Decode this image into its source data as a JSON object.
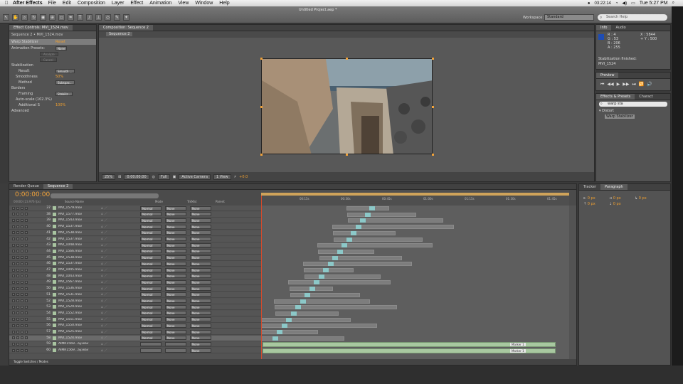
{
  "menubar": {
    "app": "After Effects",
    "items": [
      "File",
      "Edit",
      "Composition",
      "Layer",
      "Effect",
      "Animation",
      "View",
      "Window",
      "Help"
    ],
    "status": "03:22:14",
    "clock": "Tue 5:27 PM"
  },
  "toolbar": {
    "document_title": "Untitled Project.aep *",
    "workspace_label": "Workspace:",
    "workspace_value": "Standard",
    "help_placeholder": "Search Help"
  },
  "effect_controls": {
    "tab": "Effect Controls: MVI_1524.mov",
    "title": "Sequence 2 • MVI_1524.mov",
    "effect_name": "Warp Stabilizer",
    "reset_label": "Reset",
    "animation_presets_label": "Animation Presets:",
    "animation_presets_value": "None",
    "analyze_label": "Analyze",
    "cancel_label": "Cancel",
    "stabilization_label": "Stabilization",
    "result_label": "Result",
    "result_value": "Smooth ...",
    "smoothness_label": "Smoothness",
    "smoothness_value": "50%",
    "method_label": "Method",
    "method_value": "Subspac...",
    "borders_label": "Borders",
    "framing_label": "Framing",
    "framing_value": "Stabiliz...",
    "autoscale_label": "Auto-scale (102.3%)",
    "additional_scale_label": "Additional S",
    "additional_scale_value": "100%",
    "advanced_label": "Advanced"
  },
  "composition": {
    "tab": "Composition: Sequence 2",
    "sub_tab": "Sequence 2",
    "zoom": "25%",
    "timecode": "0:00:00:00",
    "resolution": "Full",
    "camera": "Active Camera",
    "views": "1 View",
    "exposure": "+0.0"
  },
  "info": {
    "tabs": [
      "Info",
      "Audio"
    ],
    "r": "R : 4",
    "g": "G : 53",
    "b": "B : 206",
    "a": "A : 255",
    "x": "X : 5844",
    "y": "+ Y : 500",
    "status_line1": "Stabilization finished:",
    "status_line2": "MVI_1524"
  },
  "preview": {
    "tab": "Preview",
    "icons": [
      "⏮",
      "◀◀",
      "▶",
      "▶▶",
      "⏭",
      "🔁",
      "🔊"
    ]
  },
  "effects_presets": {
    "tabs": [
      "Effects & Presets",
      "Charact"
    ],
    "search_value": "warp sta",
    "category": "Distort",
    "item": "Warp Stabilizer"
  },
  "paragraph": {
    "tabs": [
      "Tracker",
      "Paragraph"
    ],
    "values": [
      "0 px",
      "0 px",
      "0 px",
      "0 px",
      "0 px"
    ]
  },
  "timeline": {
    "tabs": [
      "Render Queue",
      "Sequence 2"
    ],
    "time": "0:00:00:00",
    "fps": "00000 (23.976 fps)",
    "ruler_ticks": [
      "00:15s",
      "00:30s",
      "00:45s",
      "01:00s",
      "01:15s",
      "01:30s",
      "01:45s"
    ],
    "col_headers": {
      "source_name": "Source Name",
      "mode": "Mode",
      "trkmat": "TrkMat",
      "parent": "Parent"
    },
    "layers": [
      {
        "num": "37",
        "name": "MVI_1579.mov",
        "mode": "Normal",
        "trkmat": "None",
        "parent": "None"
      },
      {
        "num": "38",
        "name": "MVI_1577.mov",
        "mode": "Normal",
        "trkmat": "None",
        "parent": "None"
      },
      {
        "num": "39",
        "name": "MVI_1543.mov",
        "mode": "Normal",
        "trkmat": "None",
        "parent": "None"
      },
      {
        "num": "40",
        "name": "MVI_1537.mov",
        "mode": "Normal",
        "trkmat": "None",
        "parent": "None"
      },
      {
        "num": "41",
        "name": "MVI_1538.mov",
        "mode": "Normal",
        "trkmat": "None",
        "parent": "None"
      },
      {
        "num": "42",
        "name": "MVI_1537.mov",
        "mode": "Normal",
        "trkmat": "None",
        "parent": "None"
      },
      {
        "num": "43",
        "name": "MVI_1048.mov",
        "mode": "Normal",
        "trkmat": "None",
        "parent": "None"
      },
      {
        "num": "44",
        "name": "MVI_1566.mov",
        "mode": "Normal",
        "trkmat": "None",
        "parent": "None"
      },
      {
        "num": "45",
        "name": "MVI_1538.mov",
        "mode": "Normal",
        "trkmat": "None",
        "parent": "None"
      },
      {
        "num": "46",
        "name": "MVI_1537.mov",
        "mode": "Normal",
        "trkmat": "None",
        "parent": "None"
      },
      {
        "num": "47",
        "name": "MVI_1045.mov",
        "mode": "Normal",
        "trkmat": "None",
        "parent": "None"
      },
      {
        "num": "48",
        "name": "MVI_1043.mov",
        "mode": "Normal",
        "trkmat": "None",
        "parent": "None"
      },
      {
        "num": "49",
        "name": "MVI_1567.mov",
        "mode": "Normal",
        "trkmat": "None",
        "parent": "None"
      },
      {
        "num": "50",
        "name": "MVI_1536.mov",
        "mode": "Normal",
        "trkmat": "None",
        "parent": "None"
      },
      {
        "num": "51",
        "name": "MVI_1531.mov",
        "mode": "Normal",
        "trkmat": "None",
        "parent": "None"
      },
      {
        "num": "52",
        "name": "MVI_1528.mov",
        "mode": "Normal",
        "trkmat": "None",
        "parent": "None"
      },
      {
        "num": "53",
        "name": "MVI_1529.mov",
        "mode": "Normal",
        "trkmat": "None",
        "parent": "None"
      },
      {
        "num": "54",
        "name": "MVI_1552.mov",
        "mode": "Normal",
        "trkmat": "None",
        "parent": "None"
      },
      {
        "num": "55",
        "name": "MVI_1551.mov",
        "mode": "Normal",
        "trkmat": "None",
        "parent": "None"
      },
      {
        "num": "56",
        "name": "MVI_1550.mov",
        "mode": "Normal",
        "trkmat": "None",
        "parent": "None"
      },
      {
        "num": "57",
        "name": "MVI_1525.mov",
        "mode": "Normal",
        "trkmat": "None",
        "parent": "None"
      },
      {
        "num": "58",
        "name": "MVI_1524.mov",
        "mode": "Normal",
        "trkmat": "None",
        "parent": "None"
      },
      {
        "num": "59",
        "name": "AIMR1569...ay.wav",
        "mode": "",
        "trkmat": "",
        "parent": "None"
      },
      {
        "num": "60",
        "name": "AIMR1569...ay.wav",
        "mode": "",
        "trkmat": "",
        "parent": "None"
      }
    ],
    "markers": [
      "Marker 1",
      "Marker 1"
    ],
    "footer": "Toggle Switches / Modes"
  }
}
